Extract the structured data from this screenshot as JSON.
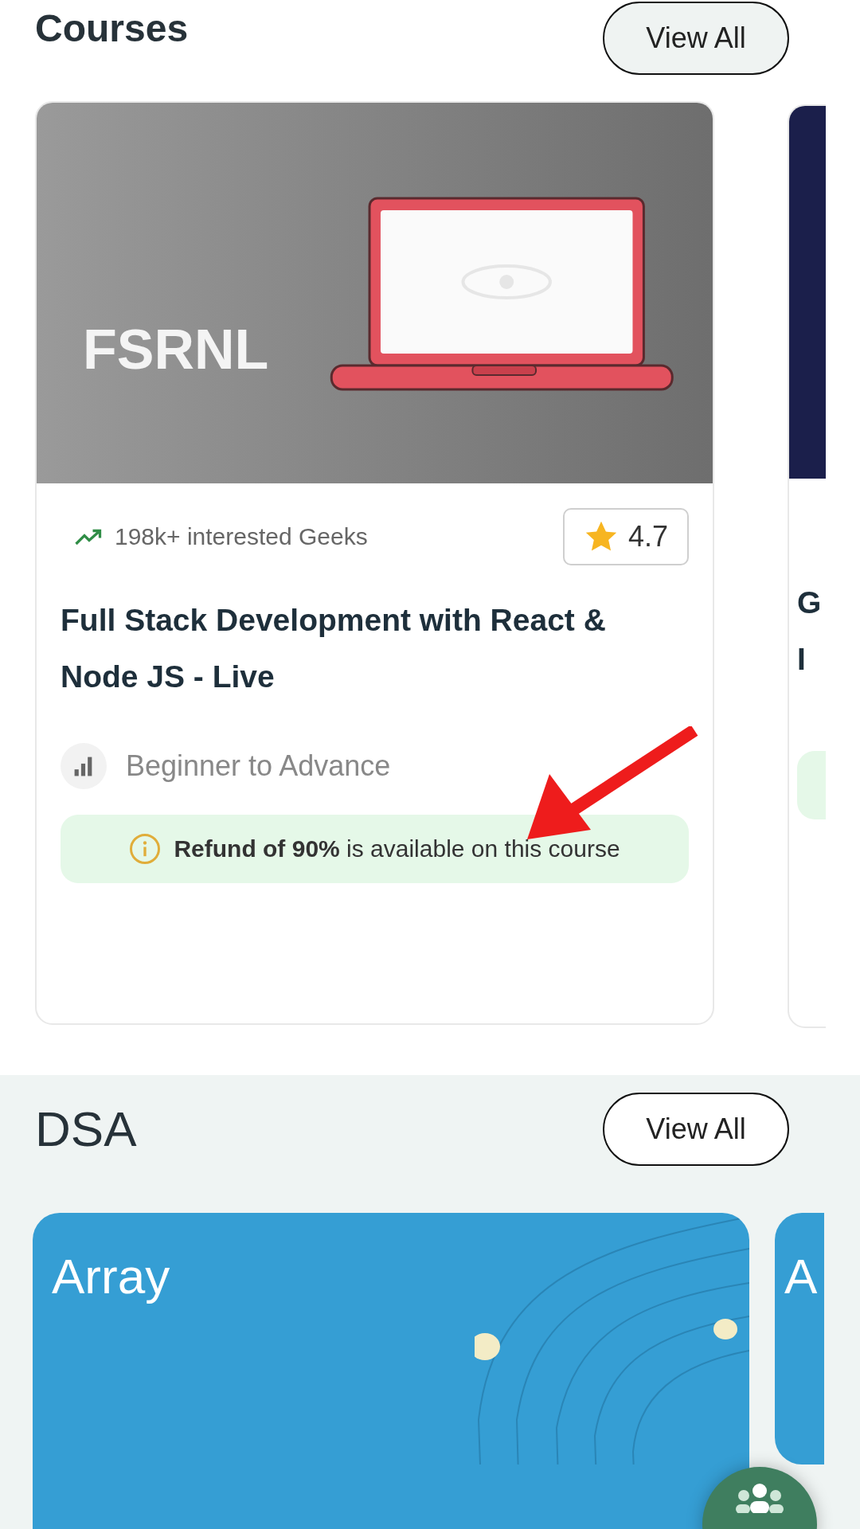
{
  "courses": {
    "title": "Courses",
    "view_all": "View All",
    "cards": [
      {
        "kind": "full",
        "image_label": "FSRNL",
        "interest": "198k+ interested Geeks",
        "rating": "4.7",
        "title": "Full Stack Development with React & Node JS - Live",
        "level": "Beginner to Advance",
        "refund": "**Refund of 90%** is available on this course"
      },
      {
        "kind": "peek",
        "title_lines": [
          "G",
          "I"
        ]
      }
    ]
  },
  "dsa": {
    "title": "DSA",
    "view_all": "View All",
    "cards": [
      {
        "kind": "full",
        "title": "Array"
      },
      {
        "kind": "peek",
        "title": "A"
      }
    ]
  }
}
